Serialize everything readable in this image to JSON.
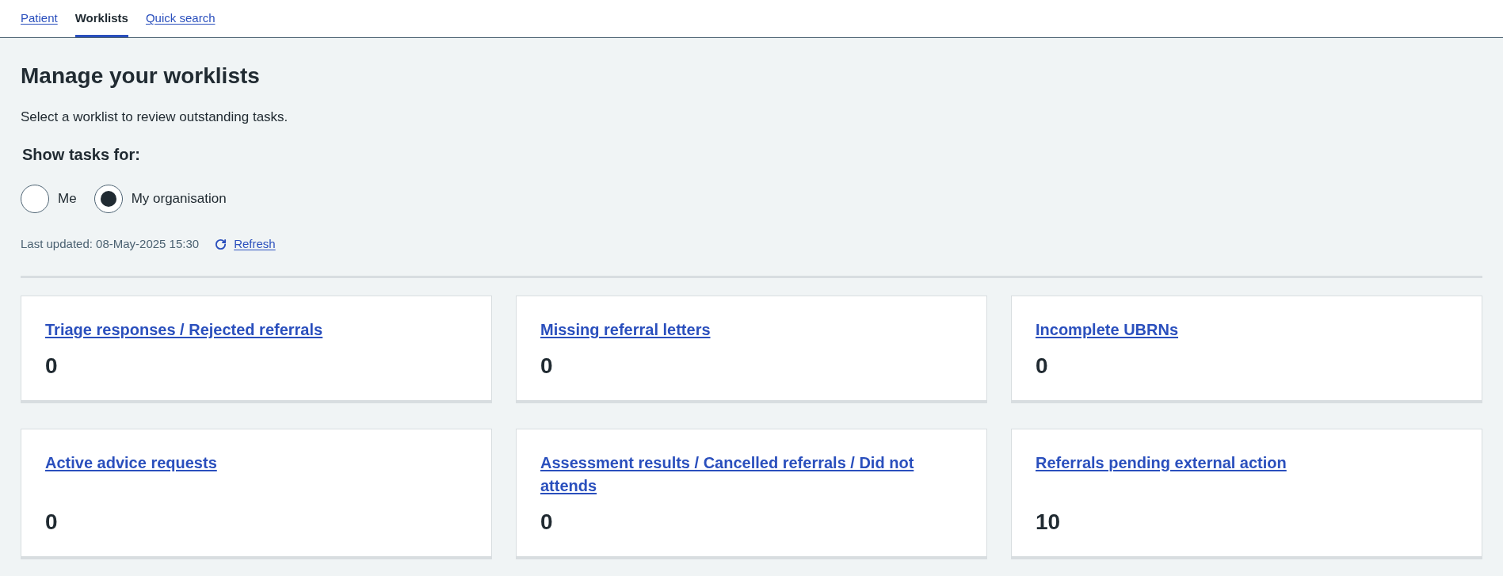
{
  "nav": {
    "tabs": [
      {
        "label": "Patient",
        "selected": false
      },
      {
        "label": "Worklists",
        "selected": true
      },
      {
        "label": "Quick search",
        "selected": false
      }
    ]
  },
  "page": {
    "title": "Manage your worklists",
    "intro": "Select a worklist to review outstanding tasks.",
    "filter": {
      "legend": "Show tasks for:",
      "options": [
        {
          "label": "Me",
          "selected": false
        },
        {
          "label": "My organisation",
          "selected": true
        }
      ]
    },
    "last_updated": "Last updated: 08-May-2025 15:30",
    "refresh_link": "Refresh"
  },
  "worklists": [
    {
      "title": "Triage responses / Rejected referrals",
      "count": "0"
    },
    {
      "title": "Missing referral letters",
      "count": "0"
    },
    {
      "title": "Incomplete UBRNs",
      "count": "0"
    },
    {
      "title": "Active advice requests",
      "count": "0"
    },
    {
      "title": "Assessment results / Cancelled referrals / Did not attends",
      "count": "0"
    },
    {
      "title": "Referrals pending external action",
      "count": "10"
    }
  ]
}
